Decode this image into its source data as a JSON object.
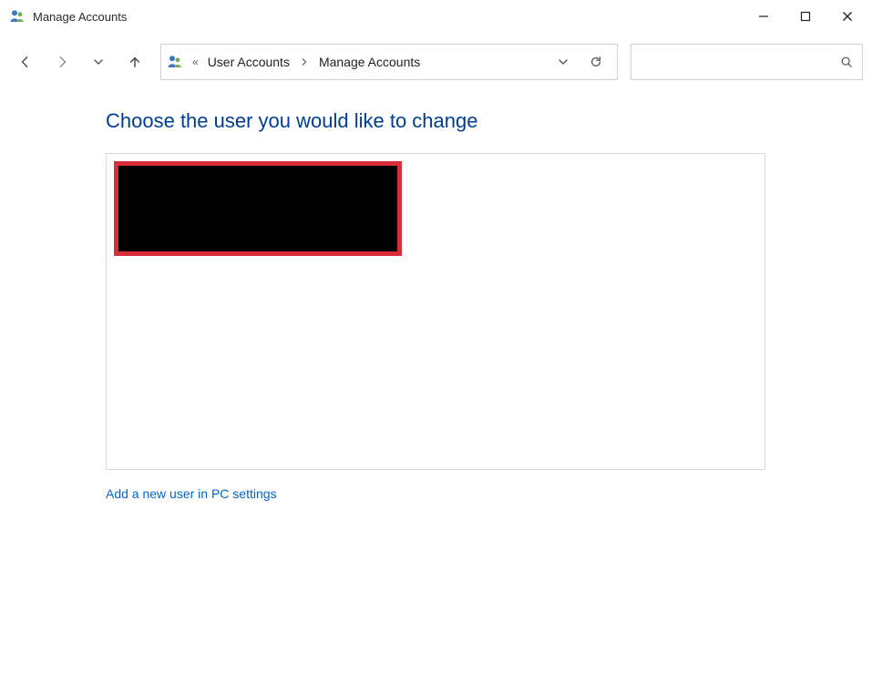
{
  "window": {
    "title": "Manage Accounts"
  },
  "breadcrumb": {
    "item1": "User Accounts",
    "item2": "Manage Accounts"
  },
  "search": {
    "placeholder": ""
  },
  "page": {
    "heading": "Choose the user you would like to change",
    "add_user_link": "Add a new user in PC settings"
  }
}
